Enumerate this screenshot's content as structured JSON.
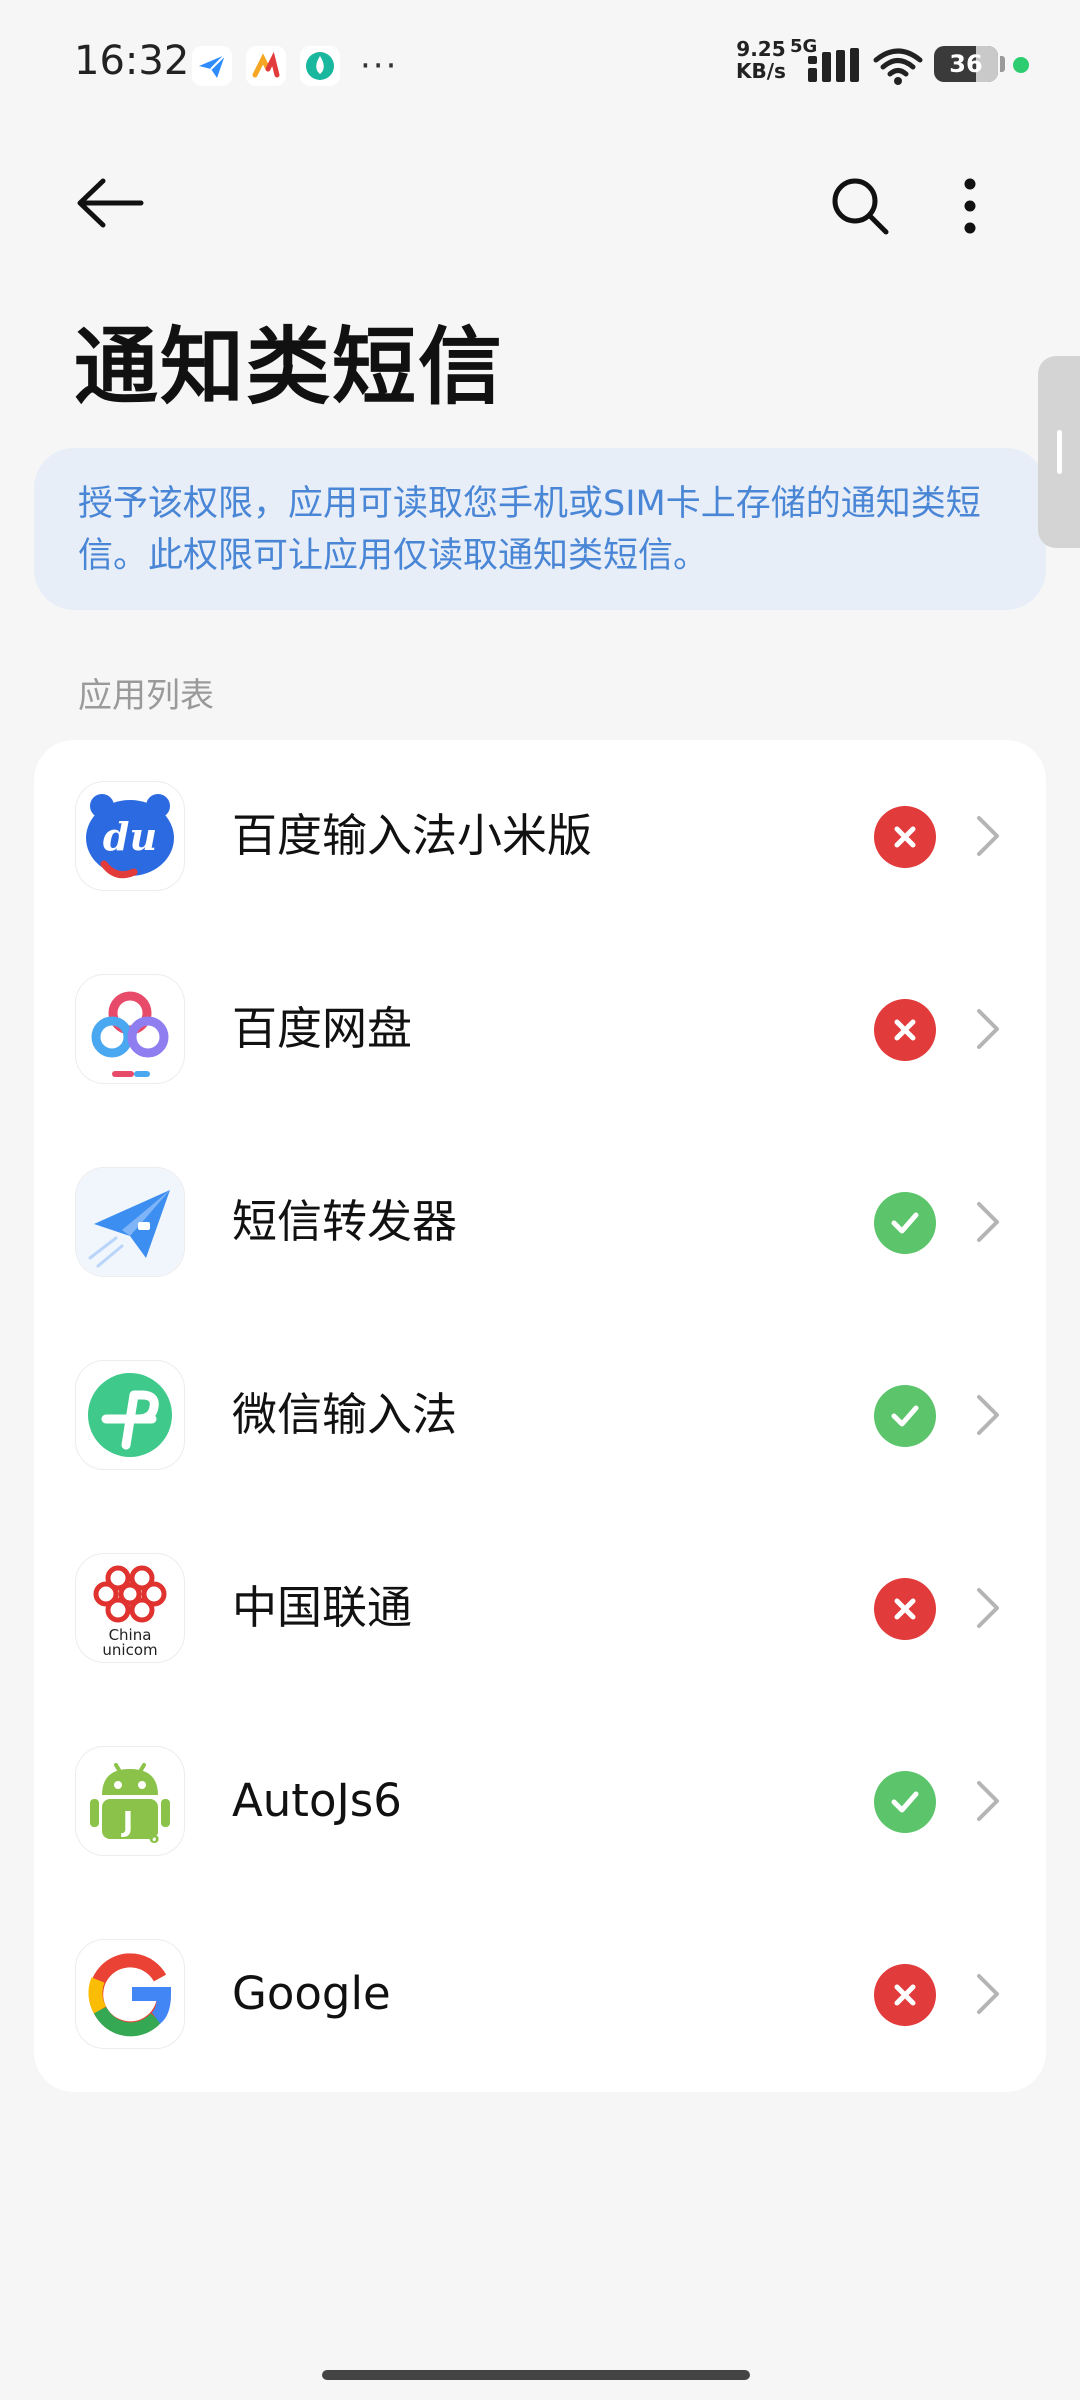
{
  "status_bar": {
    "time": "16:32",
    "net_speed_value": "9.25",
    "net_speed_unit": "KB/s",
    "network_type": "5G",
    "battery_level": "36",
    "icons": [
      "paper-plane-icon",
      "colorful-app-icon",
      "green-drop-icon"
    ],
    "more": "···"
  },
  "header": {
    "title": "通知类短信",
    "back_icon": "back-arrow-icon",
    "search_icon": "search-icon",
    "more_icon": "more-vertical-icon"
  },
  "info": {
    "text": "授予该权限，应用可读取您手机或SIM卡上存储的通知类短信。此权限可让应用仅读取通知类短信。"
  },
  "section": {
    "label": "应用列表"
  },
  "apps": [
    {
      "name": "百度输入法小米版",
      "icon": "baidu-input-icon",
      "status": "denied"
    },
    {
      "name": "百度网盘",
      "icon": "baidu-netdisk-icon",
      "status": "denied"
    },
    {
      "name": "短信转发器",
      "icon": "sms-forwarder-icon",
      "status": "allowed"
    },
    {
      "name": "微信输入法",
      "icon": "wechat-input-icon",
      "status": "allowed"
    },
    {
      "name": "中国联通",
      "icon": "china-unicom-icon",
      "status": "denied"
    },
    {
      "name": "AutoJs6",
      "icon": "autojs6-icon",
      "status": "allowed"
    },
    {
      "name": "Google",
      "icon": "google-icon",
      "status": "denied"
    }
  ],
  "icon_text": {
    "baidu_input": "du",
    "unicom_line1": "China",
    "unicom_line2": "unicom",
    "autojs_letter": "J",
    "autojs_num": "6"
  },
  "colors": {
    "deny": "#e23b3b",
    "allow": "#5cc56b",
    "info_text": "#4a86d6",
    "info_bg": "#e8eef8"
  }
}
